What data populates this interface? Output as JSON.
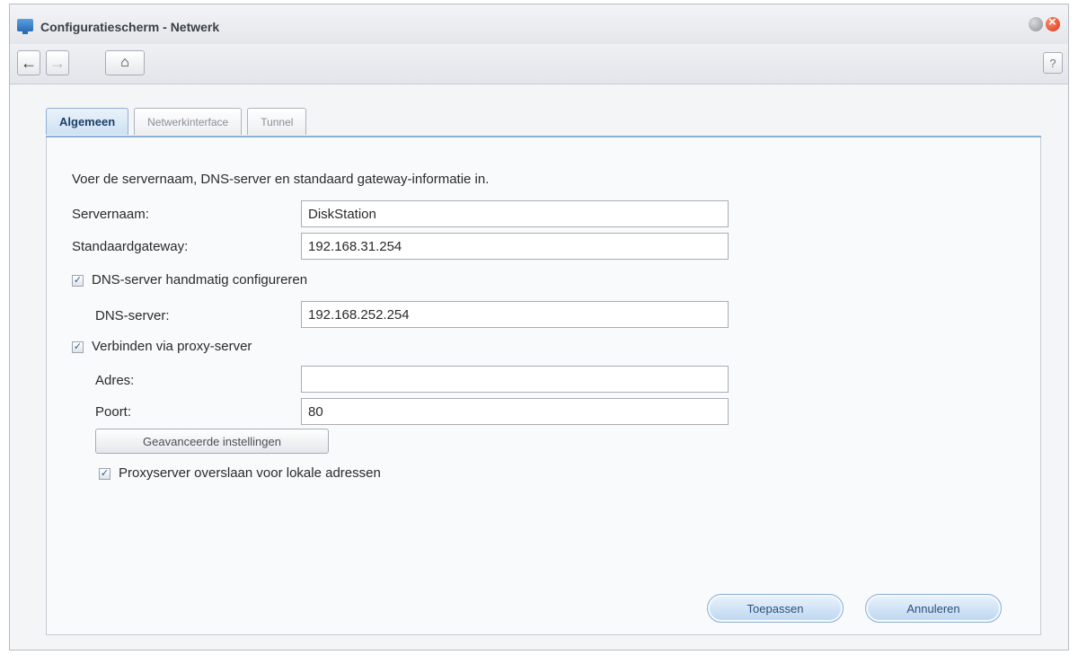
{
  "window": {
    "title": "Configuratiescherm - Netwerk"
  },
  "toolbar": {
    "back_icon": "←",
    "forward_icon": "→",
    "home_icon": "⌂",
    "help_label": "?"
  },
  "tabs": [
    {
      "label": "Algemeen",
      "active": true
    },
    {
      "label": "Netwerkinterface",
      "active": false
    },
    {
      "label": "Tunnel",
      "active": false
    }
  ],
  "form": {
    "intro": "Voer de servernaam, DNS-server en standaard gateway-informatie in.",
    "servername_label": "Servernaam:",
    "servername_value": "DiskStation",
    "gateway_label": "Standaardgateway:",
    "gateway_value": "192.168.31.254",
    "dns_manual_label": "DNS-server handmatig configureren",
    "dns_manual_checked": true,
    "dns_label": "DNS-server:",
    "dns_value": "192.168.252.254",
    "proxy_label": "Verbinden via proxy-server",
    "proxy_checked": true,
    "address_label": "Adres:",
    "address_value": "",
    "port_label": "Poort:",
    "port_value": "80",
    "advanced_button": "Geavanceerde instellingen",
    "bypass_label": "Proxyserver overslaan voor lokale adressen",
    "bypass_checked": true,
    "check_mark": "✓"
  },
  "actions": {
    "apply": "Toepassen",
    "cancel": "Annuleren"
  }
}
